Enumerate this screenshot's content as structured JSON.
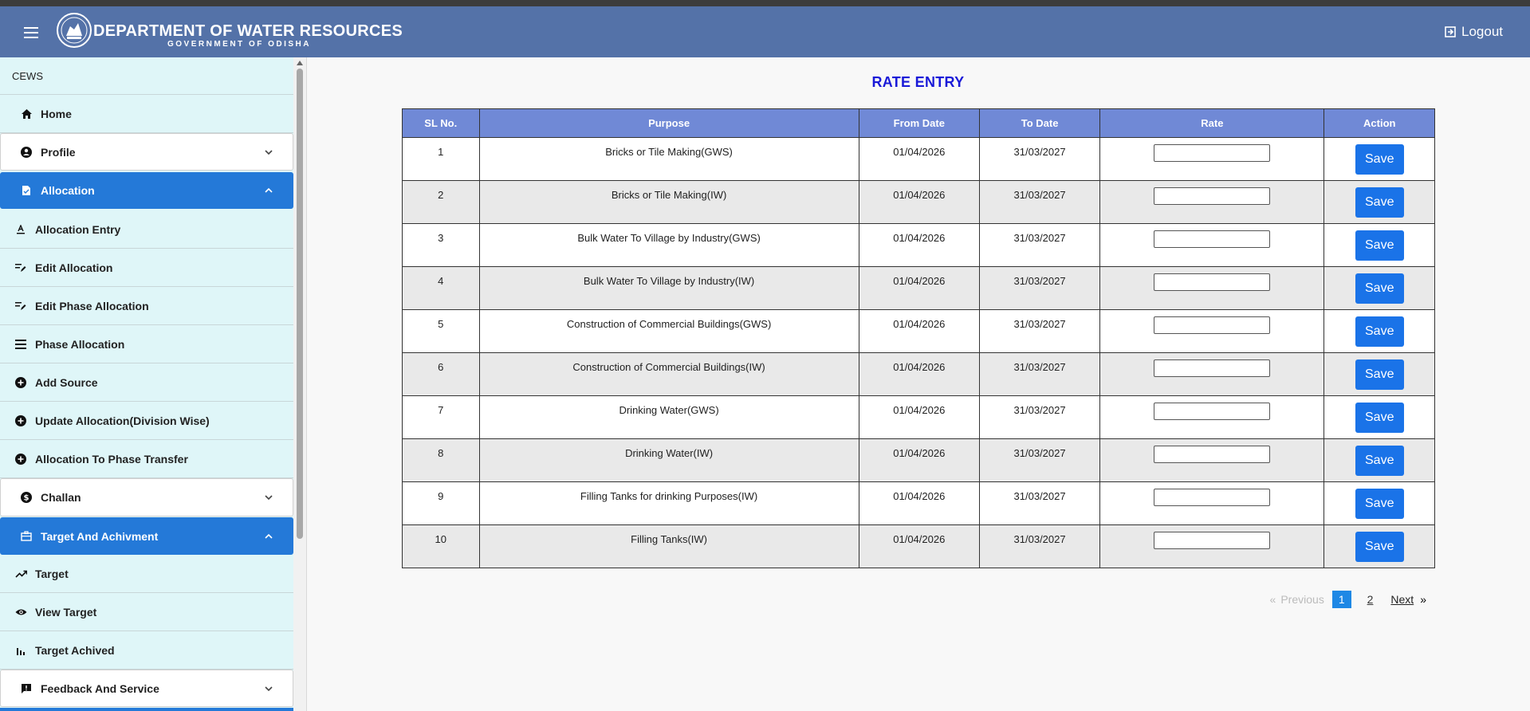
{
  "header": {
    "title": "DEPARTMENT OF WATER RESOURCES",
    "subtitle": "GOVERNMENT OF ODISHA",
    "logout_label": "Logout"
  },
  "sidebar": {
    "top_label": "CEWS",
    "home": "Home",
    "profile": "Profile",
    "allocation": "Allocation",
    "allocation_items": [
      "Allocation Entry",
      "Edit Allocation",
      "Edit Phase Allocation",
      "Phase Allocation",
      "Add Source",
      "Update Allocation(Division Wise)",
      "Allocation To Phase Transfer"
    ],
    "challan": "Challan",
    "target_section": "Target And Achivment",
    "target_items": [
      "Target",
      "View Target",
      "Target Achived"
    ],
    "feedback": "Feedback And Service"
  },
  "page": {
    "title": "RATE ENTRY"
  },
  "table": {
    "headers": [
      "SL No.",
      "Purpose",
      "From Date",
      "To Date",
      "Rate",
      "Action"
    ],
    "save_label": "Save",
    "rows": [
      {
        "sl": "1",
        "purpose": "Bricks or Tile Making(GWS)",
        "from": "01/04/2026",
        "to": "31/03/2027",
        "rate": ""
      },
      {
        "sl": "2",
        "purpose": "Bricks or Tile Making(IW)",
        "from": "01/04/2026",
        "to": "31/03/2027",
        "rate": ""
      },
      {
        "sl": "3",
        "purpose": "Bulk Water To Village by Industry(GWS)",
        "from": "01/04/2026",
        "to": "31/03/2027",
        "rate": ""
      },
      {
        "sl": "4",
        "purpose": "Bulk Water To Village by Industry(IW)",
        "from": "01/04/2026",
        "to": "31/03/2027",
        "rate": ""
      },
      {
        "sl": "5",
        "purpose": "Construction of Commercial Buildings(GWS)",
        "from": "01/04/2026",
        "to": "31/03/2027",
        "rate": ""
      },
      {
        "sl": "6",
        "purpose": "Construction of Commercial Buildings(IW)",
        "from": "01/04/2026",
        "to": "31/03/2027",
        "rate": ""
      },
      {
        "sl": "7",
        "purpose": "Drinking Water(GWS)",
        "from": "01/04/2026",
        "to": "31/03/2027",
        "rate": ""
      },
      {
        "sl": "8",
        "purpose": "Drinking Water(IW)",
        "from": "01/04/2026",
        "to": "31/03/2027",
        "rate": ""
      },
      {
        "sl": "9",
        "purpose": "Filling Tanks for drinking Purposes(IW)",
        "from": "01/04/2026",
        "to": "31/03/2027",
        "rate": ""
      },
      {
        "sl": "10",
        "purpose": "Filling Tanks(IW)",
        "from": "01/04/2026",
        "to": "31/03/2027",
        "rate": ""
      }
    ]
  },
  "pagination": {
    "prev_arrow": "«",
    "previous": "Previous",
    "pages": [
      "1",
      "2"
    ],
    "current": "1",
    "next": "Next",
    "next_arrow": "»"
  },
  "colors": {
    "header_bg": "#5472a8",
    "table_header_bg": "#7089d6",
    "save_button": "#1a73e8",
    "active_section": "#2479d8",
    "sidebar_bg": "#dff6f8",
    "title_color": "#1a1ad8"
  }
}
